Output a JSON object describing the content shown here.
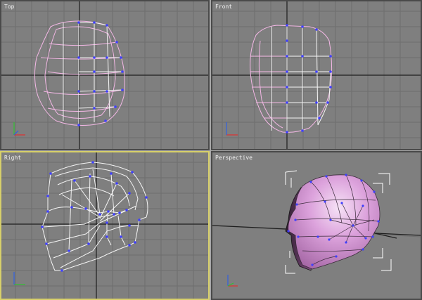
{
  "viewports": {
    "top": {
      "label": "Top"
    },
    "front": {
      "label": "Front"
    },
    "right": {
      "label": "Right"
    },
    "perspective": {
      "label": "Perspective"
    }
  },
  "active_viewport": "right",
  "colors": {
    "viewport_bg": "#7f7f7f",
    "grid_line": "#6e6e6e",
    "world_axis": "#1e1e1e",
    "active_border": "#d8d06a",
    "wire_selected": "#f4b8e6",
    "wire_white": "#f5f5f5",
    "vertex": "#4040ff",
    "mesh_fill": "#d890d8",
    "bounding_box": "#ffffff",
    "axis_x": "#e03030",
    "axis_y": "#30c030",
    "axis_z": "#3060e0"
  },
  "icons": [
    "axis-tripod-icon"
  ]
}
